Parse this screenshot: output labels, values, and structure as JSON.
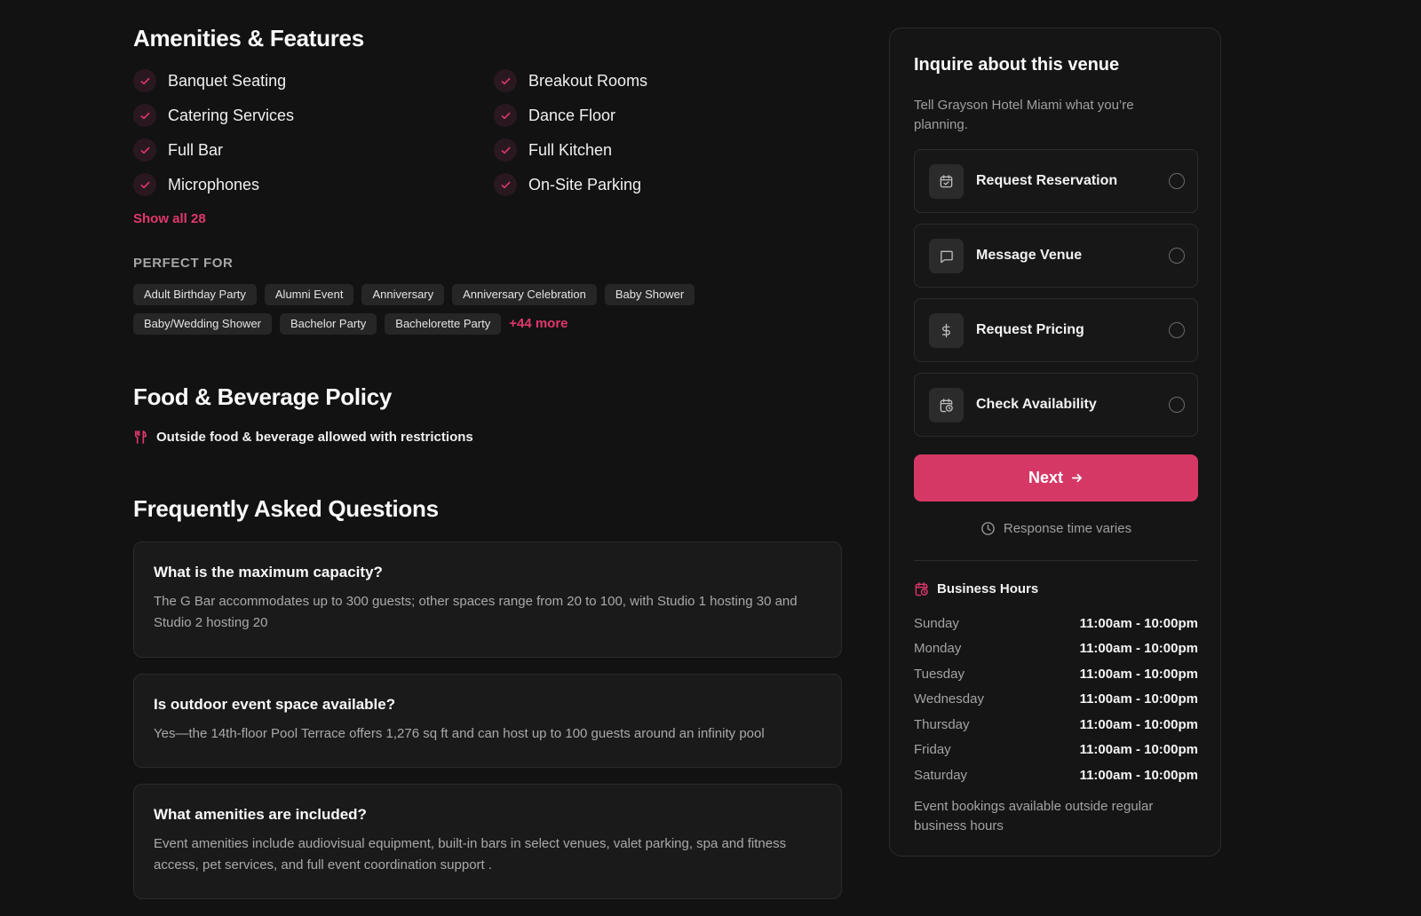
{
  "amenities": {
    "title": "Amenities & Features",
    "items": [
      "Banquet Seating",
      "Breakout Rooms",
      "Catering Services",
      "Dance Floor",
      "Full Bar",
      "Full Kitchen",
      "Microphones",
      "On-Site Parking"
    ],
    "show_all": "Show all 28"
  },
  "perfect_for": {
    "label": "PERFECT FOR",
    "tags": [
      "Adult Birthday Party",
      "Alumni Event",
      "Anniversary",
      "Anniversary Celebration",
      "Baby Shower",
      "Baby/Wedding Shower",
      "Bachelor Party",
      "Bachelorette Party"
    ],
    "more": "+44 more"
  },
  "food_beverage": {
    "title": "Food & Beverage Policy",
    "text": "Outside food & beverage allowed with restrictions",
    "icon": "utensils-icon"
  },
  "faq": {
    "title": "Frequently Asked Questions",
    "items": [
      {
        "q": "What is the maximum capacity?",
        "a": "The G Bar accommodates up to 300 guests; other spaces range from 20 to 100, with Studio 1 hosting 30 and Studio 2 hosting 20"
      },
      {
        "q": "Is outdoor event space available?",
        "a": "Yes—the 14th-floor Pool Terrace offers 1,276 sq ft and can host up to 100 guests around an infinity pool"
      },
      {
        "q": "What amenities are included?",
        "a": "Event amenities include audiovisual equipment, built-in bars in select venues, valet parking, spa and fitness access, pet services, and full event coordination support ."
      }
    ]
  },
  "inquiry": {
    "title": "Inquire about this venue",
    "subtitle": "Tell Grayson Hotel Miami what you’re planning.",
    "options": [
      {
        "label": "Request Reservation",
        "icon": "calendar-check-icon"
      },
      {
        "label": "Message Venue",
        "icon": "message-icon"
      },
      {
        "label": "Request Pricing",
        "icon": "dollar-icon"
      },
      {
        "label": "Check Availability",
        "icon": "calendar-clock-icon"
      }
    ],
    "next_label": "Next",
    "response": "Response time varies"
  },
  "business_hours": {
    "title": "Business Hours",
    "rows": [
      {
        "day": "Sunday",
        "time": "11:00am - 10:00pm"
      },
      {
        "day": "Monday",
        "time": "11:00am - 10:00pm"
      },
      {
        "day": "Tuesday",
        "time": "11:00am - 10:00pm"
      },
      {
        "day": "Wednesday",
        "time": "11:00am - 10:00pm"
      },
      {
        "day": "Thursday",
        "time": "11:00am - 10:00pm"
      },
      {
        "day": "Friday",
        "time": "11:00am - 10:00pm"
      },
      {
        "day": "Saturday",
        "time": "11:00am - 10:00pm"
      }
    ],
    "note": "Event bookings available outside regular business hours"
  },
  "colors": {
    "accent": "#e0386b",
    "button": "#d63866",
    "background": "#121213"
  }
}
